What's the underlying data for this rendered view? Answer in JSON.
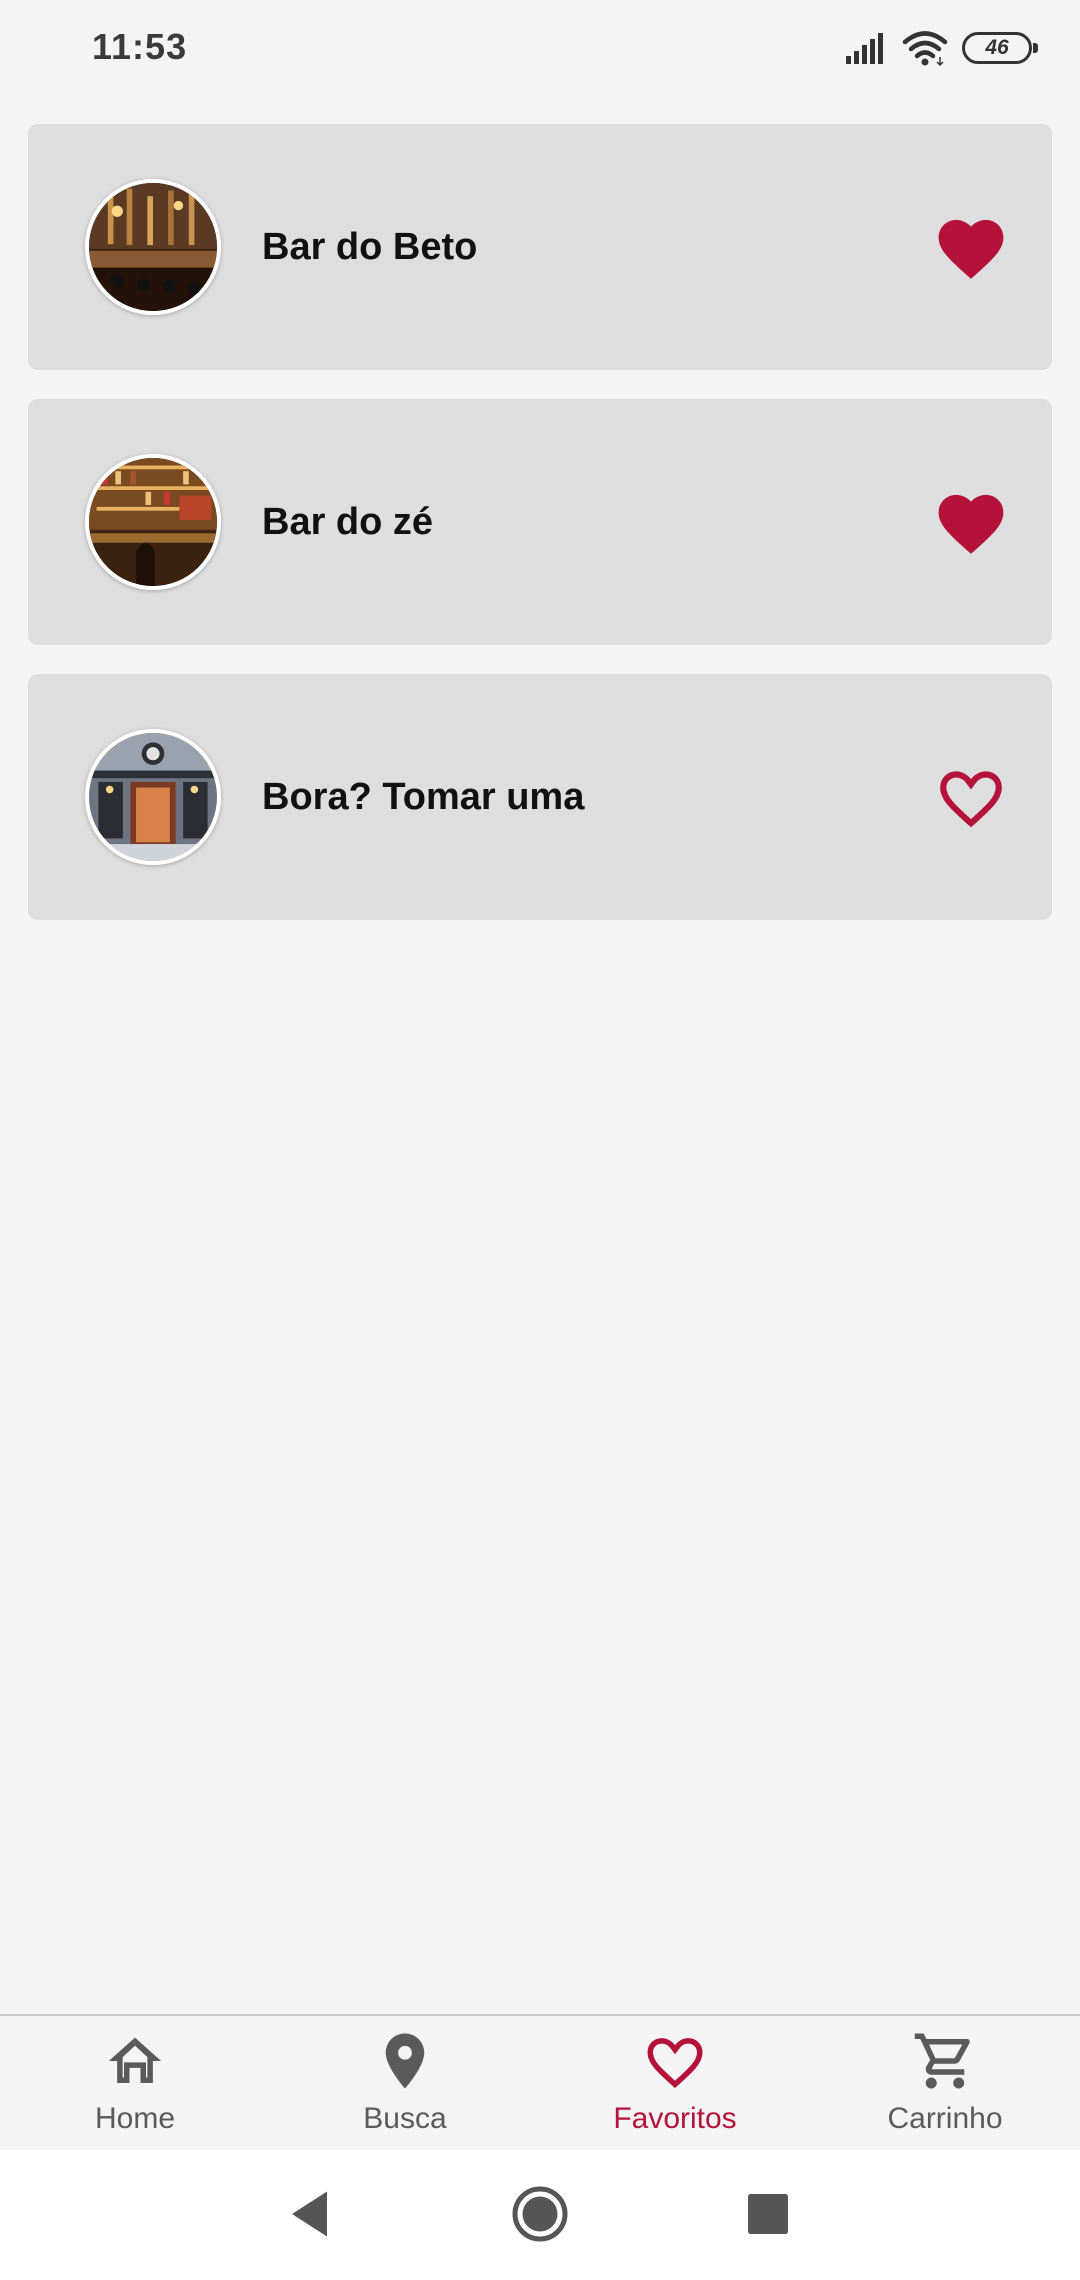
{
  "status_bar": {
    "time": "11:53",
    "battery_level": "46",
    "icons": [
      "signal-icon",
      "wifi-icon",
      "battery-icon"
    ]
  },
  "favorites": [
    {
      "name": "Bar do Beto",
      "favorited": true,
      "image": "bar-interior-photo"
    },
    {
      "name": "Bar do zé",
      "favorited": true,
      "image": "bar-shelves-photo"
    },
    {
      "name": "Bora? Tomar uma",
      "favorited": false,
      "image": "bar-storefront-photo"
    }
  ],
  "bottom_nav": {
    "items": [
      {
        "label": "Home",
        "icon": "home-icon",
        "active": false
      },
      {
        "label": "Busca",
        "icon": "location-pin-icon",
        "active": false
      },
      {
        "label": "Favoritos",
        "icon": "heart-icon",
        "active": true
      },
      {
        "label": "Carrinho",
        "icon": "cart-icon",
        "active": false
      }
    ]
  },
  "colors": {
    "accent": "#b5123a",
    "card_background": "#dedede",
    "page_background": "#f4f4f4",
    "nav_inactive": "#5a5a5a"
  }
}
